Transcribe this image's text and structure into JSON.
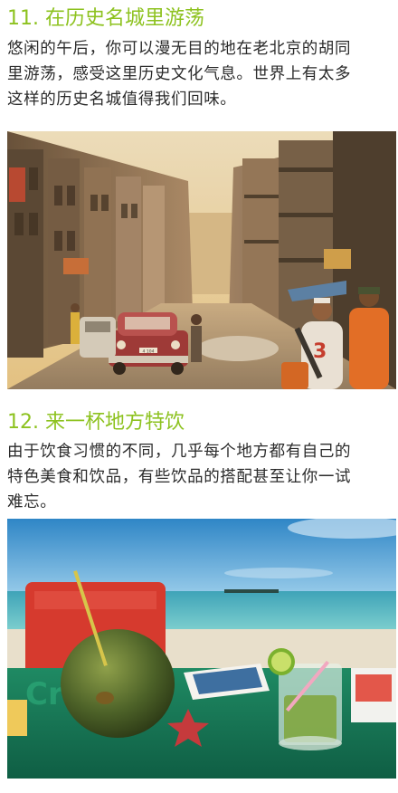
{
  "sections": [
    {
      "number": "11.",
      "title": "在历史名城里游荡",
      "body_lines": [
        "悠闲的午后，你可以漫无目的地在老北京的胡同",
        "里游荡，感受这里历史文化气息。世界上有太多",
        "这样的历史名城值得我们回味。"
      ],
      "photo": {
        "subject": "street-scene-photo",
        "car_plate": "4 104"
      }
    },
    {
      "number": "12.",
      "title": "来一杯地方特饮",
      "body_lines": [
        "由于饮食习惯的不同，几乎每个地方都有自己的",
        "特色美食和饮品，有些饮品的搭配甚至让你一试",
        "难忘。"
      ],
      "photo": {
        "subject": "beach-drinks-photo",
        "sign_text": "Cristal"
      }
    }
  ],
  "colors": {
    "heading": "#8dc21f",
    "body_text": "#2b2b2b"
  }
}
